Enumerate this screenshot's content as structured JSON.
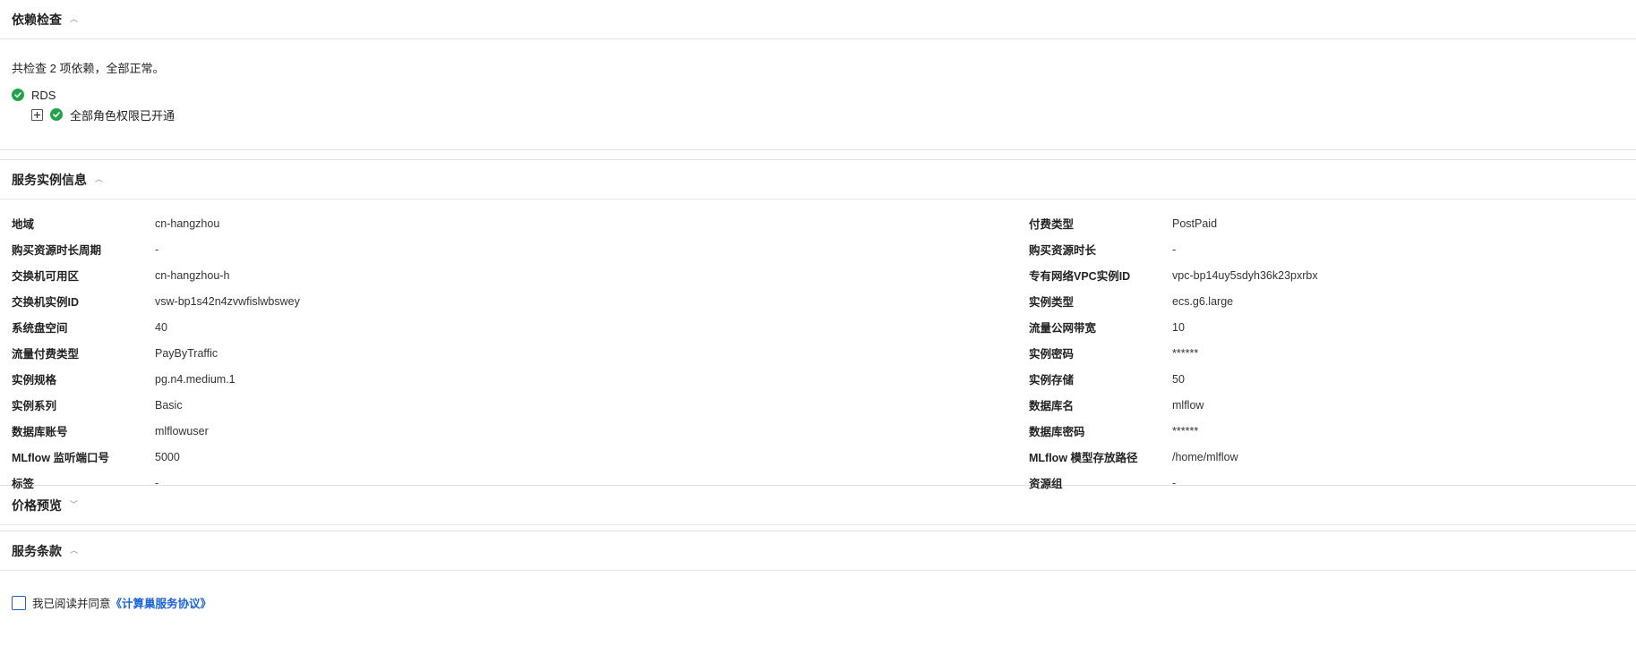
{
  "dependency": {
    "title": "依赖检查",
    "summary": "共检查 2 项依赖，全部正常。",
    "items": [
      {
        "label": "RDS",
        "status": "ok"
      }
    ],
    "children": [
      {
        "label": "全部角色权限已开通",
        "status": "ok"
      }
    ]
  },
  "instance": {
    "title": "服务实例信息",
    "left": [
      {
        "key": "地域",
        "value": "cn-hangzhou"
      },
      {
        "key": "购买资源时长周期",
        "value": "-"
      },
      {
        "key": "交换机可用区",
        "value": "cn-hangzhou-h"
      },
      {
        "key": "交换机实例ID",
        "value": "vsw-bp1s42n4zvwfislwbswey"
      },
      {
        "key": "系统盘空间",
        "value": "40"
      },
      {
        "key": "流量付费类型",
        "value": "PayByTraffic"
      },
      {
        "key": "实例规格",
        "value": "pg.n4.medium.1"
      },
      {
        "key": "实例系列",
        "value": "Basic"
      },
      {
        "key": "数据库账号",
        "value": "mlflowuser"
      },
      {
        "key": "MLflow 监听端口号",
        "value": "5000"
      },
      {
        "key": "标签",
        "value": "-"
      }
    ],
    "right": [
      {
        "key": "付费类型",
        "value": "PostPaid"
      },
      {
        "key": "购买资源时长",
        "value": "-"
      },
      {
        "key": "专有网络VPC实例ID",
        "value": "vpc-bp14uy5sdyh36k23pxrbx"
      },
      {
        "key": "实例类型",
        "value": "ecs.g6.large"
      },
      {
        "key": "流量公网带宽",
        "value": "10"
      },
      {
        "key": "实例密码",
        "value": "******"
      },
      {
        "key": "实例存储",
        "value": "50"
      },
      {
        "key": "数据库名",
        "value": "mlflow"
      },
      {
        "key": "数据库密码",
        "value": "******"
      },
      {
        "key": "MLflow 模型存放路径",
        "value": "/home/mlflow"
      },
      {
        "key": "资源组",
        "value": "-"
      }
    ]
  },
  "price": {
    "title": "价格预览"
  },
  "terms": {
    "title": "服务条款",
    "agree_text": "我已阅读并同意",
    "link_text": "《计算巢服务协议》",
    "checked": false
  },
  "colors": {
    "ok": "#22a34a",
    "link": "#1a62d6",
    "checkbox_border": "#1f5fbf"
  },
  "icons": {
    "collapse": "chevron-up-icon",
    "expand": "chevron-down-icon",
    "ok": "check-circle-icon",
    "tree_expand": "plus-square-icon"
  }
}
